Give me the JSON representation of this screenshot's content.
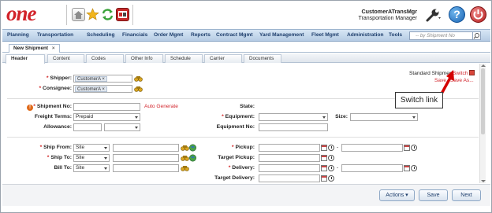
{
  "app": {
    "logo_text": "one"
  },
  "user": {
    "name": "CustomerATransMgr",
    "role": "Transportation Manager"
  },
  "menu": [
    "Planning",
    "Transportation",
    "Scheduling",
    "Financials",
    "Order Mgmt",
    "Reports",
    "Contract Mgmt",
    "Yard Management",
    "Fleet Mgmt",
    "Administration",
    "Tools"
  ],
  "search": {
    "placeholder": "-- by Shipment No"
  },
  "doc_tab": {
    "label": "New Shipment",
    "close": "×"
  },
  "tabs": [
    "Header",
    "Content",
    "Codes",
    "Other Info",
    "Schedule",
    "Carrier",
    "Documents"
  ],
  "header_links": {
    "standard_shipment": "Standard Shipment",
    "switch": "Switch",
    "save": "Save",
    "save_as": "Save As..."
  },
  "annotation": {
    "callout": "Switch link"
  },
  "form": {
    "shipper_label": "Shipper:",
    "shipper_value": "CustomerA",
    "consignee_label": "Consignee:",
    "consignee_value": "CustomerA",
    "shipment_no_label": "Shipment No:",
    "auto_generate": "Auto Generate",
    "freight_terms_label": "Freight Terms:",
    "freight_terms_value": "Prepaid",
    "allowance_label": "Allowance:",
    "state_label": "State:",
    "equipment_label": "Equipment:",
    "size_label": "Size:",
    "equipment_no_label": "Equipment No:",
    "ship_from_label": "Ship From:",
    "ship_from_value": "Site",
    "ship_to_label": "Ship To:",
    "ship_to_value": "Site",
    "bill_to_label": "Bill To:",
    "bill_to_value": "Site",
    "pickup_label": "Pickup:",
    "target_pickup_label": "Target Pickup:",
    "delivery_label": "Delivery:",
    "target_delivery_label": "Target Delivery:",
    "req_mark": "*",
    "dash": "-",
    "warn_icon": "!"
  },
  "footer": {
    "actions": "Actions ▾",
    "save": "Save",
    "next": "Next"
  }
}
